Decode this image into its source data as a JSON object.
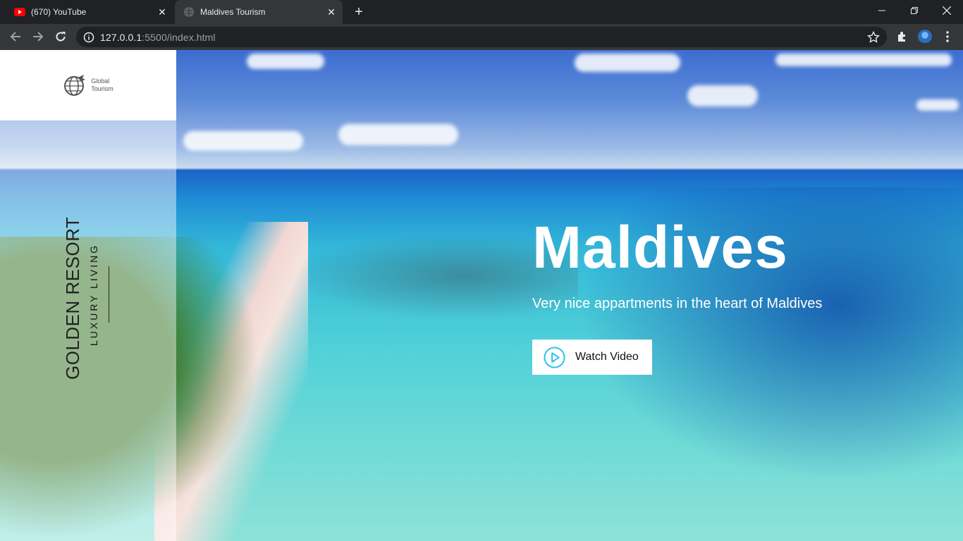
{
  "browser": {
    "tabs": [
      {
        "title": "(670) YouTube",
        "icon": "youtube-icon"
      },
      {
        "title": "Maldives Tourism",
        "icon": "globe-icon"
      }
    ],
    "url_host": "127.0.0.1",
    "url_rest": ":5500/index.html"
  },
  "sidebar": {
    "logo_line1": "Global",
    "logo_line2": "Tourism",
    "title": "GOLDEN RESORT",
    "subtitle": "LUXURY LIVING"
  },
  "hero": {
    "headline": "Maldives",
    "tagline": "Very nice appartments in the heart of Maldives",
    "cta_label": "Watch Video",
    "cta_icon": "play-circle-icon",
    "accent": "#1fc3e8"
  }
}
